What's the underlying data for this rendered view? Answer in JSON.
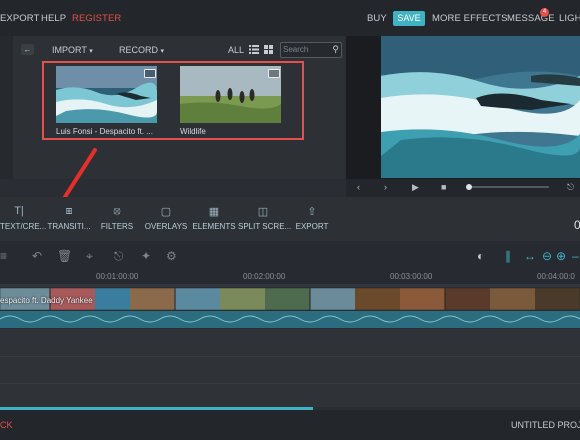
{
  "menubar": {
    "items_left": [
      "EXPORT",
      "HELP",
      "REGISTER"
    ],
    "buy": "BUY",
    "save": "SAVE",
    "more_effects": "MORE EFFECTS",
    "message": "MESSAGE",
    "message_badge": "4",
    "light": "LIGH"
  },
  "library": {
    "import": "IMPORT",
    "record": "RECORD",
    "all": "ALL",
    "search_placeholder": "Search",
    "clips": [
      {
        "label": "Luis Fonsi - Despacito ft. ..."
      },
      {
        "label": "Wildlife"
      }
    ]
  },
  "tools": [
    {
      "label": "TEXT/CRE..."
    },
    {
      "label": "TRANSITI..."
    },
    {
      "label": "FILTERS"
    },
    {
      "label": "OVERLAYS"
    },
    {
      "label": "ELEMENTS"
    },
    {
      "label": "SPLIT SCRE..."
    },
    {
      "label": "EXPORT"
    }
  ],
  "tools_right": "0",
  "ruler": [
    "00:01:00:00",
    "00:02:00:00",
    "00:03:00:00",
    "00:04:00:0"
  ],
  "track": {
    "label": "espacito ft. Daddy Yankee"
  },
  "playback": {
    "progress": 0.02
  },
  "scroll": {
    "position": 0.54
  },
  "bottom": {
    "left": "CK",
    "right": "UNTITLED PROJE"
  },
  "colors": {
    "accent": "#3fb2c3",
    "highlight": "#e4504a",
    "audio_wave": "#2b6d7e"
  }
}
